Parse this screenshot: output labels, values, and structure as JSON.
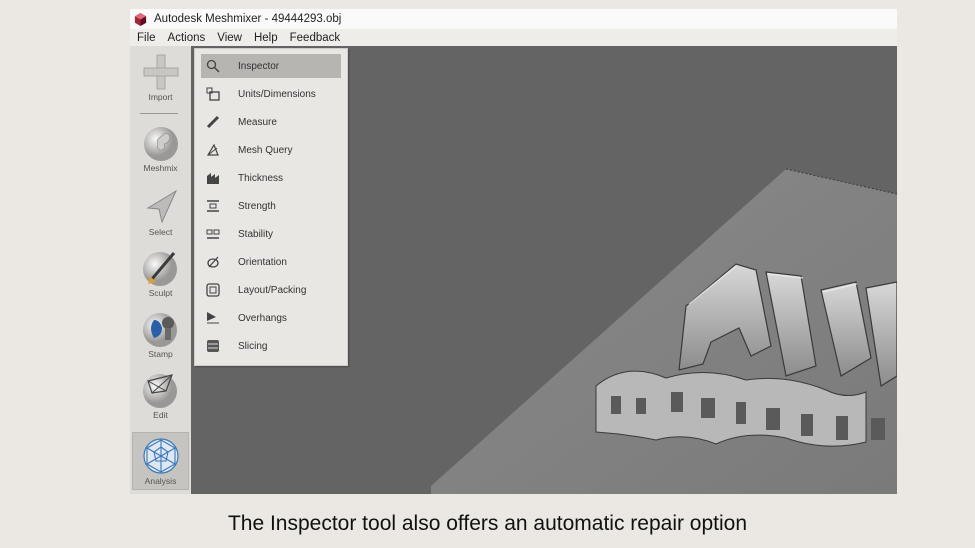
{
  "window": {
    "title": "Autodesk Meshmixer - 49444293.obj"
  },
  "menubar": {
    "items": [
      "File",
      "Actions",
      "View",
      "Help",
      "Feedback"
    ]
  },
  "toolbar": {
    "items": [
      {
        "label": "Import",
        "icon": "plus-icon"
      },
      {
        "label": "Meshmix",
        "icon": "meshmix-bunny-icon"
      },
      {
        "label": "Select",
        "icon": "select-arrow-icon"
      },
      {
        "label": "Sculpt",
        "icon": "sculpt-brush-icon"
      },
      {
        "label": "Stamp",
        "icon": "stamp-icon"
      },
      {
        "label": "Edit",
        "icon": "edit-icon"
      },
      {
        "label": "Analysis",
        "icon": "analysis-icon",
        "active": true
      }
    ]
  },
  "analysis_menu": {
    "items": [
      {
        "label": "Inspector",
        "icon": "magnifier-icon",
        "highlighted": true
      },
      {
        "label": "Units/Dimensions",
        "icon": "units-icon"
      },
      {
        "label": "Measure",
        "icon": "ruler-icon"
      },
      {
        "label": "Mesh Query",
        "icon": "mesh-query-icon"
      },
      {
        "label": "Thickness",
        "icon": "thickness-icon"
      },
      {
        "label": "Strength",
        "icon": "strength-icon"
      },
      {
        "label": "Stability",
        "icon": "stability-icon"
      },
      {
        "label": "Orientation",
        "icon": "orientation-icon"
      },
      {
        "label": "Layout/Packing",
        "icon": "layout-packing-icon"
      },
      {
        "label": "Overhangs",
        "icon": "overhangs-icon"
      },
      {
        "label": "Slicing",
        "icon": "slicing-icon"
      }
    ]
  },
  "caption": "The Inspector tool also offers an automatic repair option",
  "colors": {
    "viewport": "#646464",
    "menu_bg": "#e9e7e3",
    "highlight": "#b7b5b1",
    "analysis_accent": "#3a78b8"
  }
}
